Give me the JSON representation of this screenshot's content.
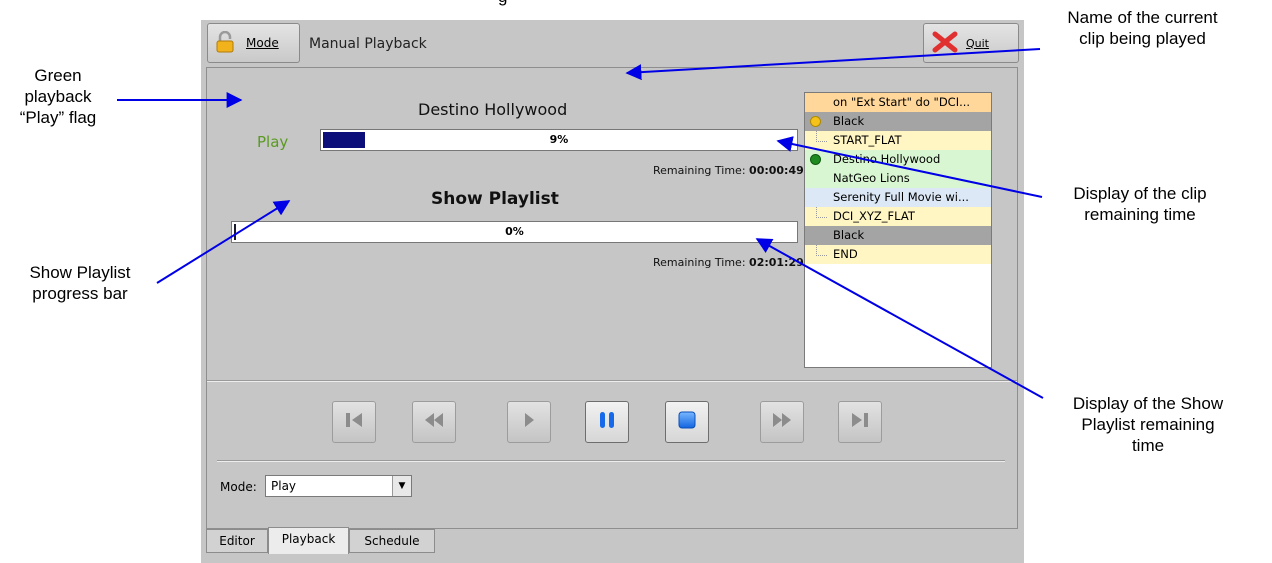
{
  "partial_heading": "g",
  "annotations": {
    "play_flag": "Green\nplayback\n“Play” flag",
    "clip_name": "Name of the current\nclip being played",
    "show_progress": "Show Playlist\nprogress bar",
    "clip_remaining": "Display of the clip\nremaining time",
    "show_remaining": "Display of the Show\nPlaylist remaining\ntime"
  },
  "header": {
    "mode_button": "Mode",
    "title": "Manual Playback",
    "quit_button": "Quit"
  },
  "clip": {
    "name": "Destino Hollywood",
    "status": "Play",
    "progress_percent": 9,
    "progress_label": "9%",
    "remaining_label": "Remaining Time:",
    "remaining_value": "00:00:49"
  },
  "show": {
    "title": "Show Playlist",
    "progress_percent": 0,
    "progress_label": "0%",
    "remaining_label": "Remaining Time:",
    "remaining_value": "02:01:29"
  },
  "playlist": [
    {
      "text": "on \"Ext Start\" do \"DCI...",
      "bg": "#ffd79a",
      "marker": "none"
    },
    {
      "text": "Black",
      "bg": "#a4a4a4",
      "marker": "yellow-dot"
    },
    {
      "text": "START_FLAT",
      "bg": "#fff6c4",
      "marker": "tree"
    },
    {
      "text": "Destino Hollywood",
      "bg": "#d9f6d2",
      "marker": "green-dot"
    },
    {
      "text": "NatGeo Lions",
      "bg": "#d9f6d2",
      "marker": "none"
    },
    {
      "text": "Serenity Full Movie wi...",
      "bg": "#dce8f6",
      "marker": "none"
    },
    {
      "text": "DCI_XYZ_FLAT",
      "bg": "#fff6c4",
      "marker": "tree"
    },
    {
      "text": "Black",
      "bg": "#a4a4a4",
      "marker": "none"
    },
    {
      "text": "END",
      "bg": "#fff6c4",
      "marker": "tree"
    }
  ],
  "transport": {
    "buttons": [
      "skip-to-start",
      "rewind",
      "play",
      "pause",
      "stop",
      "fast-forward",
      "skip-to-end"
    ],
    "active": [
      "pause",
      "stop"
    ]
  },
  "mode_select": {
    "label": "Mode:",
    "value": "Play"
  },
  "tabs": [
    {
      "label": "Editor",
      "active": false
    },
    {
      "label": "Playback",
      "active": true
    },
    {
      "label": "Schedule",
      "active": false
    }
  ],
  "colors": {
    "arrow": "#0000e6",
    "play_green": "#5a9a22",
    "progress_fill": "#0c0f7a",
    "panel_bg": "#c6c6c6"
  }
}
